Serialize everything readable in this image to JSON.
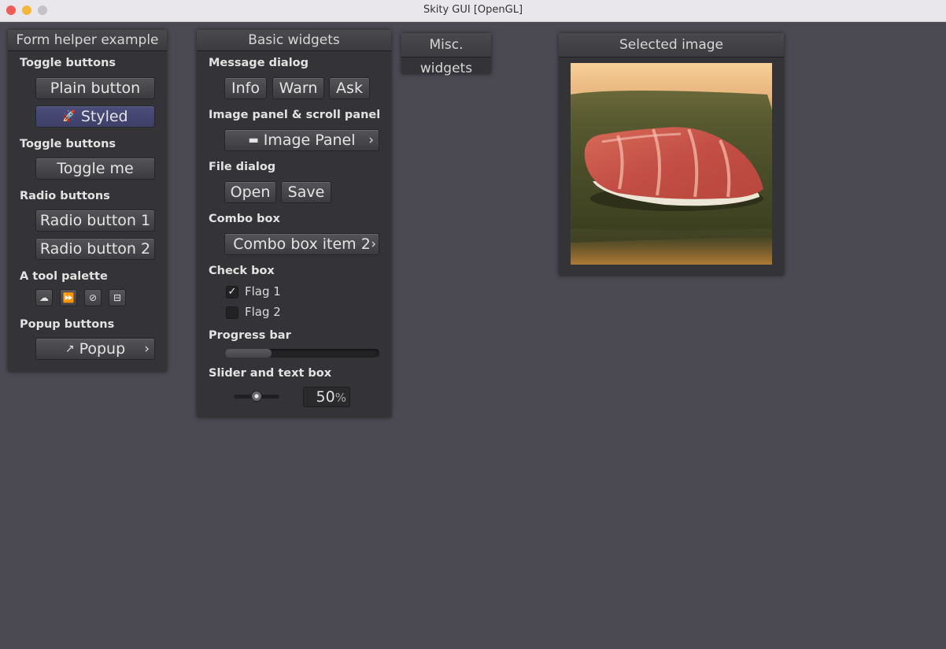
{
  "app": {
    "title": "Skity GUI [OpenGL]"
  },
  "form_helper": {
    "title": "Form helper example",
    "toggle_label_1": "Toggle buttons",
    "plain_button": "Plain button",
    "styled_button": "Styled",
    "styled_icon": "rocket-icon",
    "toggle_label_2": "Toggle buttons",
    "toggle_me": "Toggle me",
    "radio_label": "Radio buttons",
    "radio_1": "Radio button 1",
    "radio_2": "Radio button 2",
    "tool_palette_label": "A tool palette",
    "tools": [
      "cloud-icon",
      "fast-forward-icon",
      "compass-icon",
      "inbox-icon"
    ],
    "popup_label": "Popup buttons",
    "popup_button": "Popup",
    "popup_icon": "export-icon"
  },
  "basic_widgets": {
    "title": "Basic widgets",
    "message_dialog_label": "Message dialog",
    "info": "Info",
    "warn": "Warn",
    "ask": "Ask",
    "image_panel_label": "Image panel & scroll panel",
    "image_panel_button": "Image Panel",
    "image_panel_icon": "folder-icon",
    "file_dialog_label": "File dialog",
    "open": "Open",
    "save": "Save",
    "combo_box_label": "Combo box",
    "combo_value": "Combo box item 2",
    "check_box_label": "Check box",
    "flag_1": "Flag 1",
    "flag_1_checked": true,
    "flag_2": "Flag 2",
    "flag_2_checked": false,
    "progress_label": "Progress bar",
    "progress_value": 0.3,
    "slider_label": "Slider and text box",
    "slider_value": 0.5,
    "textbox_value": "50",
    "textbox_unit": "%"
  },
  "misc_widgets": {
    "title": "Misc. widgets"
  },
  "selected_image": {
    "title": "Selected image",
    "description": "sushi-photo"
  },
  "colors": {
    "background": "#4b4a53",
    "panel": "#343438",
    "styled_button": "#4b4e7a"
  }
}
